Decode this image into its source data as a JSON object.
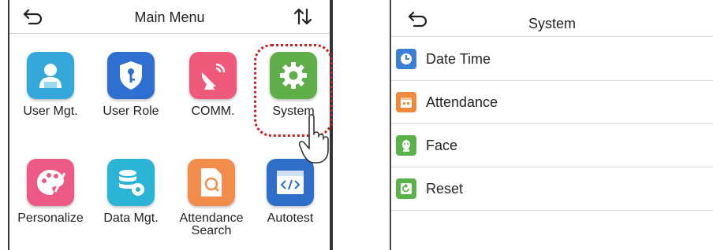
{
  "main_menu": {
    "title": "Main Menu",
    "items": [
      {
        "label": "User Mgt.",
        "icon": "user-icon",
        "color": "#34a9d9"
      },
      {
        "label": "User Role",
        "icon": "shield-key-icon",
        "color": "#2f6fd0"
      },
      {
        "label": "COMM.",
        "icon": "satellite-dish-icon",
        "color": "#ef5a7b"
      },
      {
        "label": "System",
        "icon": "gear-icon",
        "color": "#5fae4a"
      },
      {
        "label": "Personalize",
        "icon": "palette-icon",
        "color": "#ee5a86"
      },
      {
        "label": "Data Mgt.",
        "icon": "database-gear-icon",
        "color": "#2bb4d6"
      },
      {
        "label": "Attendance",
        "label2": "Search",
        "icon": "document-search-icon",
        "color": "#f28c4a"
      },
      {
        "label": "Autotest",
        "icon": "code-window-icon",
        "color": "#2f6ec9"
      }
    ]
  },
  "system_menu": {
    "title": "System",
    "items": [
      {
        "label": "Date Time",
        "icon": "clock-icon",
        "color": "#3b7fd4"
      },
      {
        "label": "Attendance",
        "icon": "calendar-icon",
        "color": "#ef8a3c"
      },
      {
        "label": "Face",
        "icon": "face-icon",
        "color": "#5ab24a"
      },
      {
        "label": "Reset",
        "icon": "reset-icon",
        "color": "#5ab24a"
      }
    ]
  },
  "highlight_color": "#cc1f1f"
}
